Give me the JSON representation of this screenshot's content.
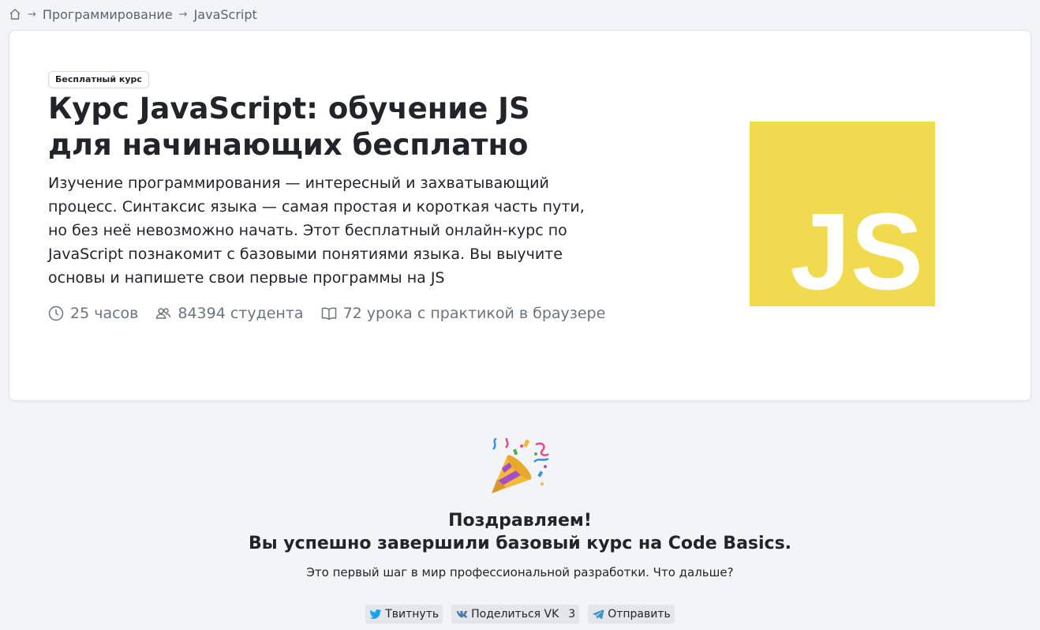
{
  "breadcrumb": {
    "home_icon": "home-icon",
    "separator": "→",
    "items": [
      "Программирование",
      "JavaScript"
    ]
  },
  "course": {
    "badge": "Бесплатный курс",
    "title": "Курс JavaScript: обучение JS для начинающих бесплатно",
    "description": "Изучение программирования — интересный и захватывающий процесс. Синтаксис языка — самая простая и короткая часть пути, но без неё невозможно начать. Этот бесплатный онлайн-курс по JavaScript познакомит с базовыми понятиями языка. Вы выучите основы и напишете свои первые программы на JS",
    "stats": {
      "duration": "25 часов",
      "students": "84394 студента",
      "lessons": "72 урока с практикой в браузере"
    },
    "logo_text": "JS",
    "logo_color": "#f0db4f"
  },
  "congrats": {
    "icon": "party-popper-icon",
    "line1": "Поздравляем!",
    "line2": "Вы успешно завершили базовый курс на Code Basics.",
    "subtitle": "Это первый шаг в мир профессиональной разработки. Что дальше?"
  },
  "share": {
    "twitter": "Твитнуть",
    "vk": "Поделиться VK",
    "vk_count": "3",
    "telegram": "Отправить"
  }
}
